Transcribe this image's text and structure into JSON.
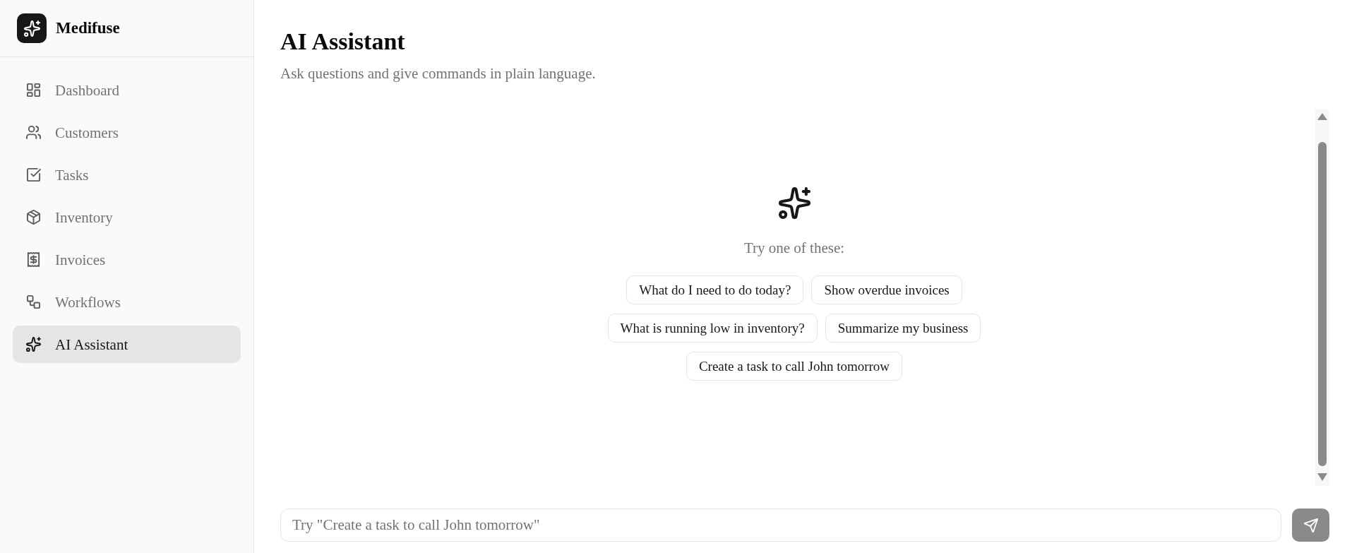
{
  "sidebar": {
    "brand": "Medifuse",
    "items": [
      {
        "label": "Dashboard",
        "selected": false
      },
      {
        "label": "Customers",
        "selected": false
      },
      {
        "label": "Tasks",
        "selected": false
      },
      {
        "label": "Inventory",
        "selected": false
      },
      {
        "label": "Invoices",
        "selected": false
      },
      {
        "label": "Workflows",
        "selected": false
      },
      {
        "label": "AI Assistant",
        "selected": true
      }
    ]
  },
  "header": {
    "title": "AI Assistant",
    "subtitle": "Ask questions and give commands in plain language."
  },
  "empty_state": {
    "prompt": "Try one of these:",
    "suggestions": [
      "What do I need to do today?",
      "Show overdue invoices",
      "What is running low in inventory?",
      "Summarize my business",
      "Create a task to call John tomorrow"
    ]
  },
  "composer": {
    "placeholder": "Try \"Create a task to call John tomorrow\"",
    "send_button": {
      "disabled": true
    }
  }
}
